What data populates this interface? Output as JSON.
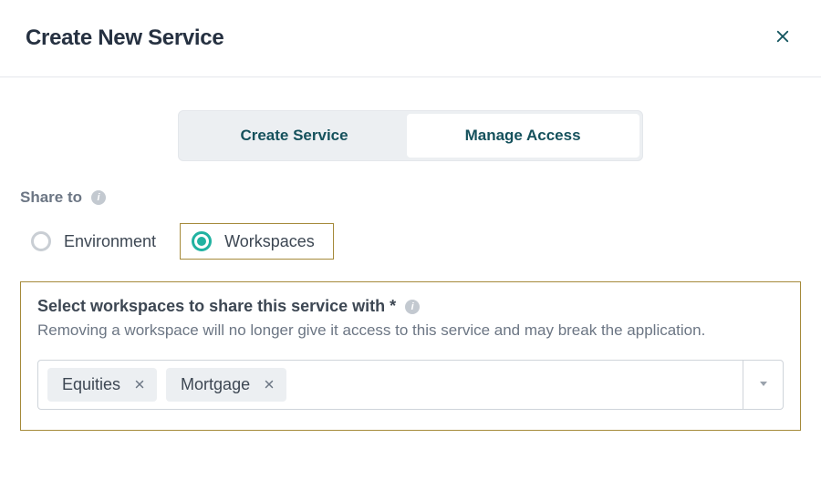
{
  "modal": {
    "title": "Create New Service"
  },
  "tabs": {
    "create": "Create Service",
    "manage": "Manage Access"
  },
  "share_to": {
    "label": "Share to",
    "options": {
      "environment": "Environment",
      "workspaces": "Workspaces"
    }
  },
  "select_section": {
    "heading": "Select workspaces to share this service with *",
    "helper": "Removing a workspace will no longer give it access to this service and may break the application.",
    "chips": {
      "equities": "Equities",
      "mortgage": "Mortgage"
    }
  }
}
